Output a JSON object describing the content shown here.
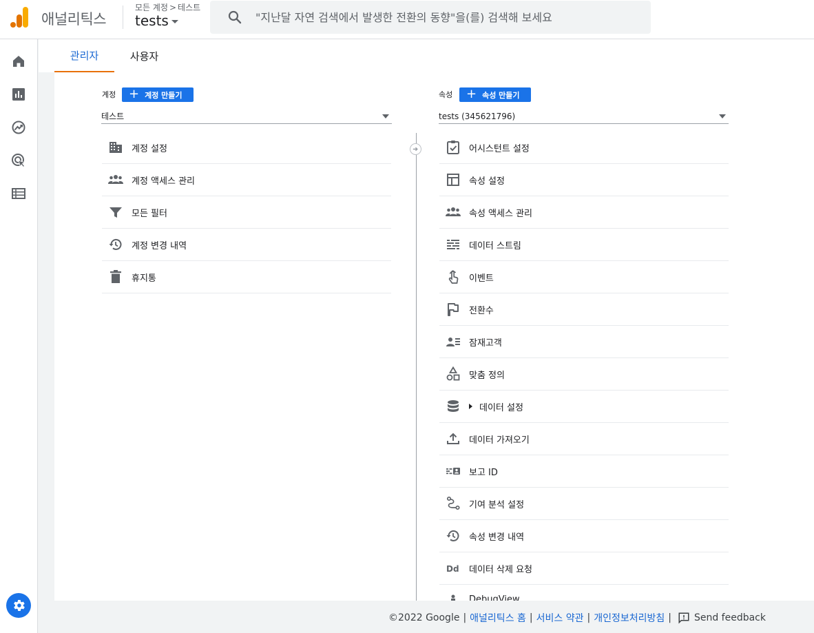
{
  "header": {
    "brand": "애널리틱스",
    "breadcrumb_root": "모든 계정",
    "breadcrumb_sep": ">",
    "breadcrumb_account": "테스트",
    "property_name": "tests",
    "search_placeholder": "\"지난달 자연 검색에서 발생한 전환의 동향\"을(를) 검색해 보세요"
  },
  "colors": {
    "accent": "#1a73e8",
    "tab_indicator": "#e8710a",
    "logo_orange": "#f9ab00",
    "logo_dark_orange": "#e37400"
  },
  "tabs": [
    {
      "label": "관리자",
      "active": true
    },
    {
      "label": "사용자",
      "active": false
    }
  ],
  "account_column": {
    "label": "계정",
    "create_button": "계정 만들기",
    "selected": "테스트",
    "items": [
      {
        "label": "계정 설정",
        "icon": "building-icon"
      },
      {
        "label": "계정 액세스 관리",
        "icon": "people-icon"
      },
      {
        "label": "모든 필터",
        "icon": "filter-icon"
      },
      {
        "label": "계정 변경 내역",
        "icon": "history-icon"
      },
      {
        "label": "휴지통",
        "icon": "trash-icon"
      }
    ]
  },
  "property_column": {
    "label": "속성",
    "create_button": "속성 만들기",
    "selected": "tests (345621796)",
    "items": [
      {
        "label": "어시스턴트 설정",
        "icon": "assignment-check-icon"
      },
      {
        "label": "속성 설정",
        "icon": "web-layout-icon"
      },
      {
        "label": "속성 액세스 관리",
        "icon": "people-icon"
      },
      {
        "label": "데이터 스트림",
        "icon": "data-stream-icon"
      },
      {
        "label": "이벤트",
        "icon": "touch-icon"
      },
      {
        "label": "전환수",
        "icon": "flag-icon"
      },
      {
        "label": "잠재고객",
        "icon": "audience-icon"
      },
      {
        "label": "맞춤 정의",
        "icon": "shapes-icon"
      },
      {
        "label": "데이터 설정",
        "icon": "database-icon",
        "expandable": true
      },
      {
        "label": "데이터 가져오기",
        "icon": "upload-icon"
      },
      {
        "label": "보고 ID",
        "icon": "reporting-id-icon"
      },
      {
        "label": "기여 분석 설정",
        "icon": "attribution-icon"
      },
      {
        "label": "속성 변경 내역",
        "icon": "history-icon"
      },
      {
        "label": "데이터 삭제 요청",
        "icon": "data-deletion-icon"
      },
      {
        "label": "DebugView",
        "icon": "debug-icon"
      }
    ]
  },
  "footer": {
    "copyright": "©2022 Google",
    "sep": "|",
    "link_home": "애널리틱스 홈",
    "link_terms": "서비스 약관",
    "link_privacy": "개인정보처리방침",
    "feedback": "Send feedback"
  }
}
